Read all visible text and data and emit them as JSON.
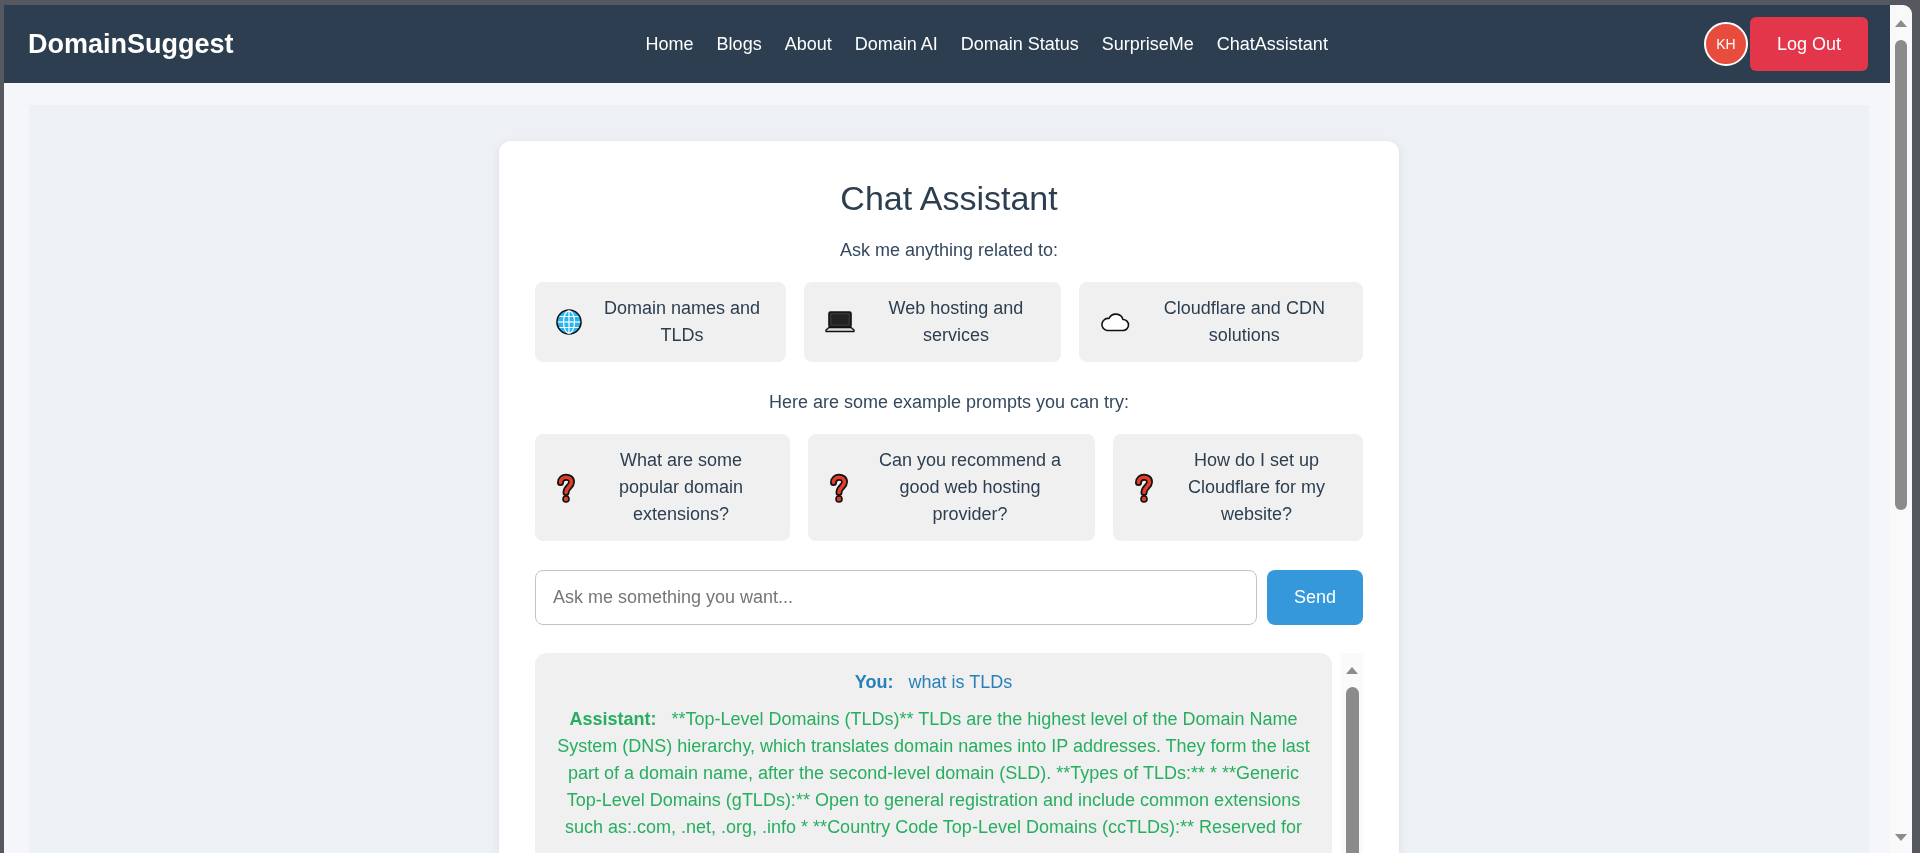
{
  "navbar": {
    "brand": "DomainSuggest",
    "links": [
      {
        "label": "Home"
      },
      {
        "label": "Blogs"
      },
      {
        "label": "About"
      },
      {
        "label": "Domain AI"
      },
      {
        "label": "Domain Status"
      },
      {
        "label": "SurpriseMe"
      },
      {
        "label": "ChatAssistant"
      }
    ],
    "avatar": {
      "initials": "KH"
    },
    "logout_button": "Log Out"
  },
  "chat_assistant": {
    "title": "Chat Assistant",
    "topics_heading": "Ask me anything related to:",
    "topics": [
      {
        "kind": "domains",
        "label": "Domain names and TLDs"
      },
      {
        "kind": "hosting",
        "label": "Web hosting and services"
      },
      {
        "kind": "cdn",
        "label": "Cloudflare and CDN solutions"
      }
    ],
    "prompts_heading": "Here are some example prompts you can try:",
    "prompts": [
      {
        "label": "What are some popular domain extensions?"
      },
      {
        "label": "Can you recommend a good web hosting provider?"
      },
      {
        "label": "How do I set up Cloudflare for my website?"
      }
    ],
    "input": {
      "placeholder": "Ask me something you want..."
    },
    "send_button": "Send",
    "messages": [
      {
        "kind": "user",
        "speaker": "You:",
        "text": "what is TLDs"
      },
      {
        "kind": "assistant",
        "speaker": "Assistant:",
        "text": "**Top-Level Domains (TLDs)** TLDs are the highest level of the Domain Name System (DNS) hierarchy, which translates domain names into IP addresses. They form the last part of a domain name, after the second-level domain (SLD). **Types of TLDs:** * **Generic Top-Level Domains (gTLDs):** Open to general registration and include common extensions such as:.com, .net, .org, .info * **Country Code Top-Level Domains (ccTLDs):** Reserved for"
      }
    ]
  }
}
